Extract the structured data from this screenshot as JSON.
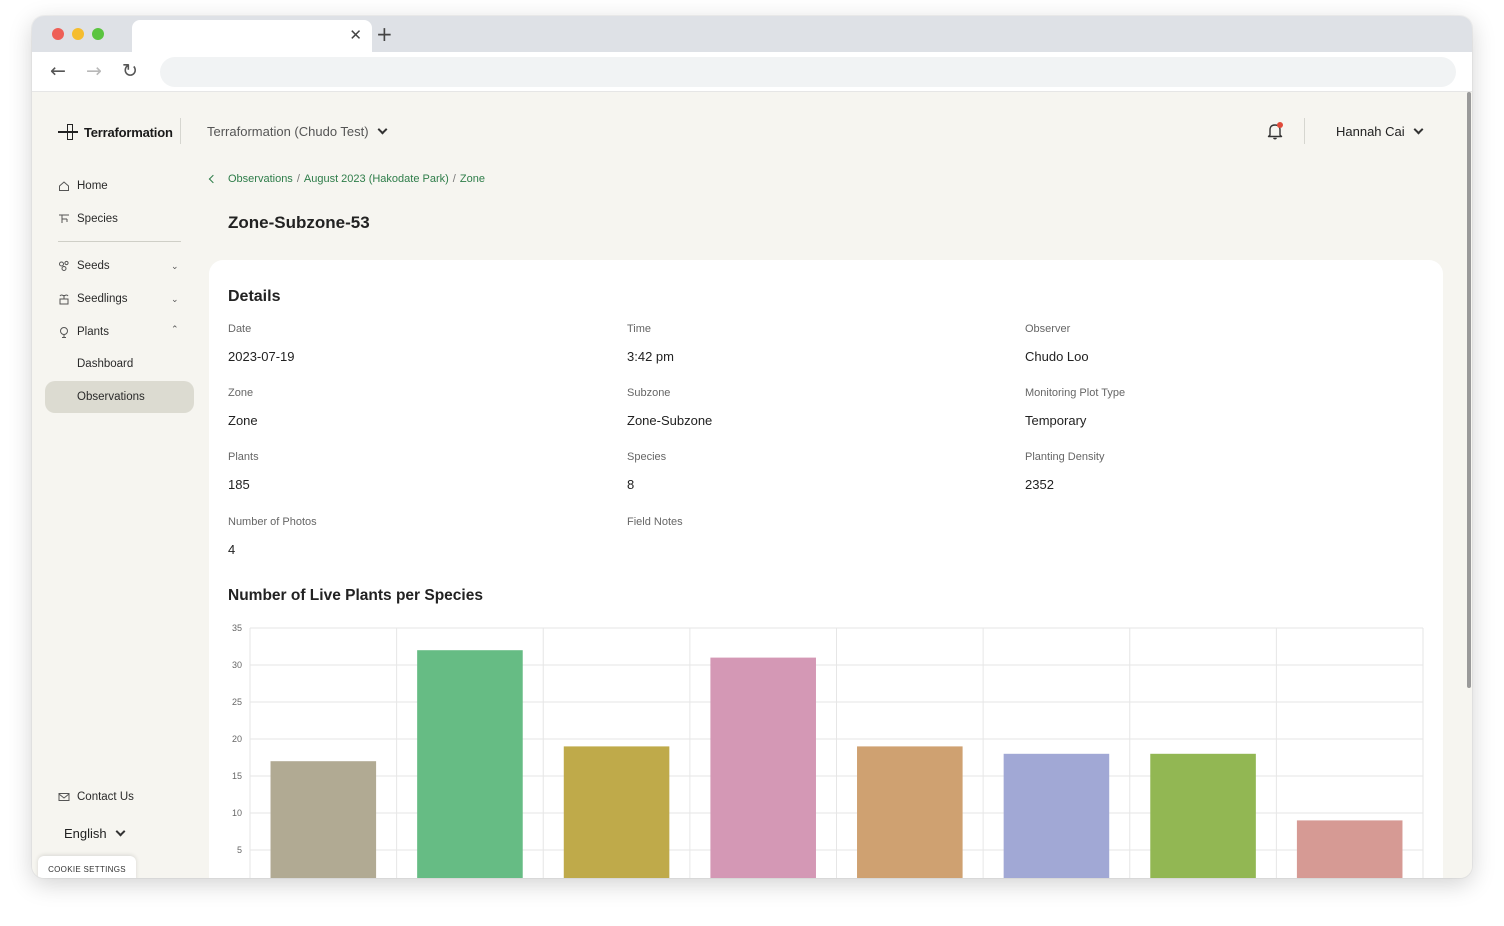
{
  "brand": {
    "name": "Terraformation"
  },
  "header": {
    "org": "Terraformation (Chudo Test)",
    "user": "Hannah Cai"
  },
  "sidebar": {
    "items": [
      {
        "label": "Home"
      },
      {
        "label": "Species"
      },
      {
        "label": "Seeds"
      },
      {
        "label": "Seedlings"
      },
      {
        "label": "Plants"
      }
    ],
    "plants_sub": [
      {
        "label": "Dashboard"
      },
      {
        "label": "Observations"
      }
    ],
    "contact": "Contact Us",
    "language": "English",
    "cookie": "COOKIE SETTINGS"
  },
  "breadcrumb": [
    "Observations",
    "August 2023 (Hakodate Park)",
    "Zone"
  ],
  "page_title": "Zone-Subzone-53",
  "details": {
    "title": "Details",
    "fields": [
      {
        "label": "Date",
        "value": "2023-07-19"
      },
      {
        "label": "Time",
        "value": "3:42 pm"
      },
      {
        "label": "Observer",
        "value": "Chudo Loo"
      },
      {
        "label": "Zone",
        "value": "Zone"
      },
      {
        "label": "Subzone",
        "value": "Zone-Subzone"
      },
      {
        "label": "Monitoring Plot Type",
        "value": "Temporary"
      },
      {
        "label": "Plants",
        "value": "185"
      },
      {
        "label": "Species",
        "value": "8"
      },
      {
        "label": "Planting Density",
        "value": "2352"
      },
      {
        "label": "Number of Photos",
        "value": "4"
      },
      {
        "label": "Field Notes",
        "value": ""
      }
    ]
  },
  "chart_data": {
    "type": "bar",
    "title": "Number of Live Plants per Species",
    "categories": [
      "",
      "",
      "",
      "",
      "",
      "",
      "",
      ""
    ],
    "values": [
      17,
      32,
      19,
      31,
      19,
      18,
      18,
      9
    ],
    "colors": [
      "#b1aa93",
      "#66bc84",
      "#bfaa4a",
      "#d498b5",
      "#cfa171",
      "#a1a8d5",
      "#92b753",
      "#d69a94"
    ],
    "yticks": [
      5,
      10,
      15,
      20,
      25,
      30,
      35
    ],
    "ylim": [
      0,
      35
    ],
    "grid": true
  }
}
